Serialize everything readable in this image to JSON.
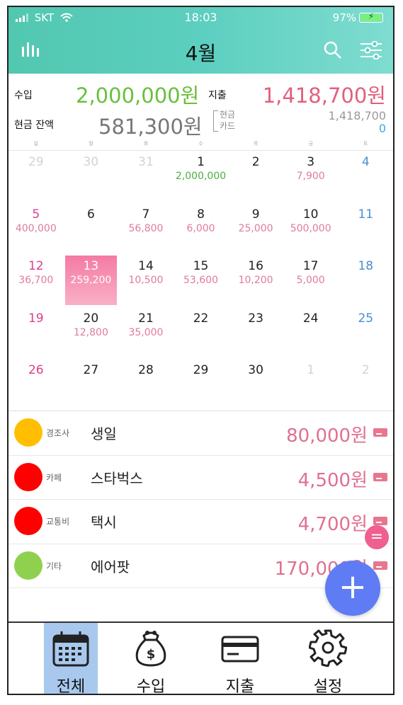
{
  "status": {
    "carrier": "SKT",
    "time": "18:03",
    "battery": "97%"
  },
  "header": {
    "title": "4월"
  },
  "summary": {
    "income_label": "수입",
    "income_value": "2,000,000원",
    "expense_label": "지출",
    "expense_value": "1,418,700원",
    "cash_balance_label": "현금 잔액",
    "cash_balance_value": "581,300원",
    "cash_label": "현금",
    "card_label": "카드",
    "cash_amount": "1,418,700",
    "card_amount": "0"
  },
  "weekdays": [
    "일",
    "월",
    "화",
    "수",
    "목",
    "금",
    "토"
  ],
  "calendar": [
    [
      {
        "d": "29",
        "t": "muted"
      },
      {
        "d": "30",
        "t": "muted"
      },
      {
        "d": "31",
        "t": "muted"
      },
      {
        "d": "1",
        "a": "2,000,000",
        "c": "green"
      },
      {
        "d": "2"
      },
      {
        "d": "3",
        "a": "7,900",
        "c": "pink"
      },
      {
        "d": "4",
        "t": "sat"
      }
    ],
    [
      {
        "d": "5",
        "t": "sun",
        "a": "400,000",
        "c": "pink"
      },
      {
        "d": "6"
      },
      {
        "d": "7",
        "a": "56,800",
        "c": "pink"
      },
      {
        "d": "8",
        "a": "6,000",
        "c": "pink"
      },
      {
        "d": "9",
        "a": "25,000",
        "c": "pink"
      },
      {
        "d": "10",
        "a": "500,000",
        "c": "pink"
      },
      {
        "d": "11",
        "t": "sat"
      }
    ],
    [
      {
        "d": "12",
        "t": "sun",
        "a": "36,700",
        "c": "pink"
      },
      {
        "d": "13",
        "t": "today",
        "a": "259,200",
        "c": "pink"
      },
      {
        "d": "14",
        "a": "10,500",
        "c": "pink"
      },
      {
        "d": "15",
        "a": "53,600",
        "c": "pink"
      },
      {
        "d": "16",
        "a": "10,200",
        "c": "pink"
      },
      {
        "d": "17",
        "a": "5,000",
        "c": "pink"
      },
      {
        "d": "18",
        "t": "sat"
      }
    ],
    [
      {
        "d": "19",
        "t": "sun"
      },
      {
        "d": "20",
        "a": "12,800",
        "c": "pink"
      },
      {
        "d": "21",
        "a": "35,000",
        "c": "pink"
      },
      {
        "d": "22"
      },
      {
        "d": "23"
      },
      {
        "d": "24"
      },
      {
        "d": "25",
        "t": "sat"
      }
    ],
    [
      {
        "d": "26",
        "t": "sun"
      },
      {
        "d": "27"
      },
      {
        "d": "28"
      },
      {
        "d": "29"
      },
      {
        "d": "30"
      },
      {
        "d": "1",
        "t": "muted"
      },
      {
        "d": "2",
        "t": "muted"
      }
    ]
  ],
  "transactions": [
    {
      "category": "경조사",
      "name": "생일",
      "amount": "80,000원",
      "color": "#ffbf00"
    },
    {
      "category": "카페",
      "name": "스타벅스",
      "amount": "4,500원",
      "color": "#ff0000"
    },
    {
      "category": "교통비",
      "name": "택시",
      "amount": "4,700원",
      "color": "#ff0000"
    },
    {
      "category": "기타",
      "name": "에어팟",
      "amount": "170,000원",
      "color": "#8fd14f"
    }
  ],
  "fab": {
    "add_symbol": "+",
    "equals_symbol": "="
  },
  "tabs": [
    {
      "label": "전체",
      "icon": "calendar-icon"
    },
    {
      "label": "수입",
      "icon": "money-pouch-icon"
    },
    {
      "label": "지출",
      "icon": "credit-card-icon"
    },
    {
      "label": "설정",
      "icon": "gear-icon"
    }
  ]
}
